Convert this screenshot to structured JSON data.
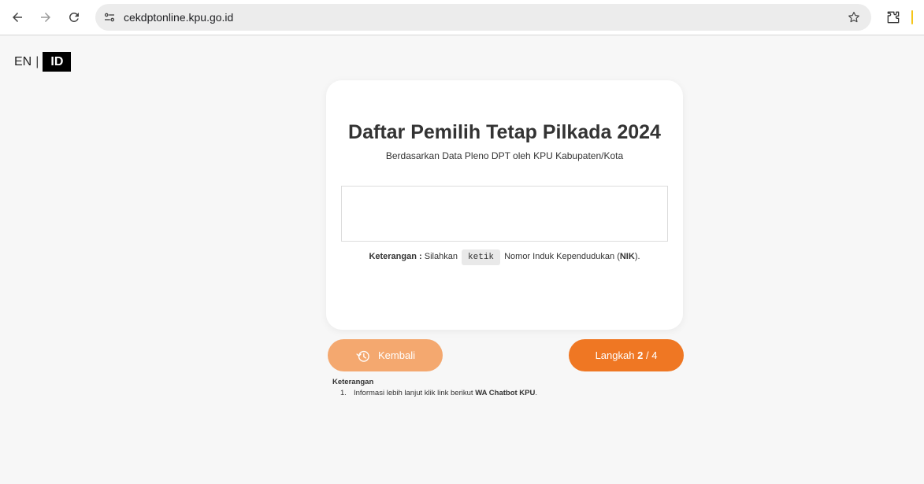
{
  "browser": {
    "url": "cekdptonline.kpu.go.id",
    "icons": [
      "back-arrow-icon",
      "forward-arrow-icon",
      "reload-icon",
      "site-info-icon",
      "bookmark-star-icon",
      "extensions-icon"
    ]
  },
  "language": {
    "en": "EN",
    "separator": "|",
    "id": "ID",
    "active": "ID"
  },
  "card": {
    "title": "Daftar Pemilih Tetap Pilkada 2024",
    "subtitle": "Berdasarkan Data Pleno DPT oleh KPU Kabupaten/Kota",
    "input_value": "",
    "hint_label": "Keterangan :",
    "hint_pre": "Silahkan",
    "hint_code": "ketik",
    "hint_post": "Nomor Induk Kependudukan (",
    "hint_bold": "NIK",
    "hint_end": ")."
  },
  "buttons": {
    "back_label": "Kembali",
    "next_prefix": "Langkah",
    "next_step": "2",
    "next_sep": "/",
    "next_total": "4"
  },
  "notes": {
    "title": "Keterangan",
    "items": [
      {
        "num": "1.",
        "text": "Informasi lebih lanjut klik link berikut",
        "bold": "WA Chatbot KPU",
        "end": "."
      }
    ]
  },
  "colors": {
    "page_bg": "#f7f7f7",
    "primary_orange": "#ef7723",
    "light_orange": "#f4a86f",
    "lang_active_bg": "#000000"
  }
}
